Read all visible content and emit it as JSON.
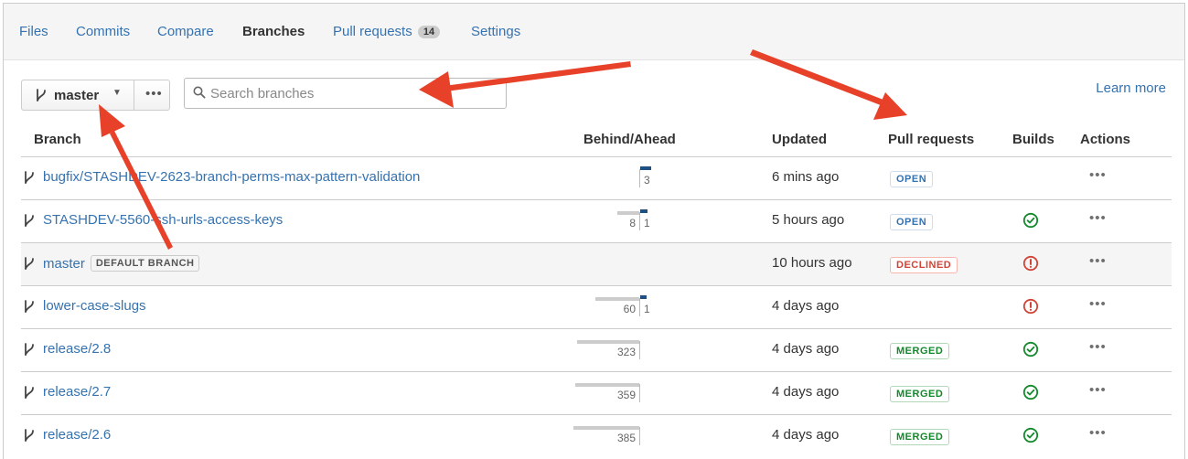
{
  "tabs": [
    {
      "label": "Files"
    },
    {
      "label": "Commits"
    },
    {
      "label": "Compare"
    },
    {
      "label": "Branches"
    },
    {
      "label": "Pull requests",
      "count": "14"
    },
    {
      "label": "Settings"
    }
  ],
  "toolbar": {
    "branch_selector": "master",
    "more_label": "•••",
    "search_placeholder": "Search branches",
    "learn_more": "Learn more"
  },
  "columns": {
    "branch": "Branch",
    "behind_ahead": "Behind/Ahead",
    "updated": "Updated",
    "pull_requests": "Pull requests",
    "builds": "Builds",
    "actions": "Actions"
  },
  "rows": [
    {
      "name": "bugfix/STASHDEV-2623-branch-perms-max-pattern-validation",
      "behind": "",
      "ahead": "3",
      "updated": "6 mins ago",
      "pr_status": "OPEN",
      "build": "",
      "actions": "•••"
    },
    {
      "name": "STASHDEV-5560-ssh-urls-access-keys",
      "behind": "8",
      "ahead": "1",
      "updated": "5 hours ago",
      "pr_status": "OPEN",
      "build": "success",
      "actions": "•••"
    },
    {
      "name": "master",
      "badge": "DEFAULT BRANCH",
      "behind": "",
      "ahead": "",
      "updated": "10 hours ago",
      "pr_status": "DECLINED",
      "build": "failed",
      "actions": "•••"
    },
    {
      "name": "lower-case-slugs",
      "behind": "60",
      "ahead": "1",
      "updated": "4 days ago",
      "pr_status": "",
      "build": "failed",
      "actions": "•••"
    },
    {
      "name": "release/2.8",
      "behind": "323",
      "ahead": "",
      "updated": "4 days ago",
      "pr_status": "MERGED",
      "build": "success",
      "actions": "•••"
    },
    {
      "name": "release/2.7",
      "behind": "359",
      "ahead": "",
      "updated": "4 days ago",
      "pr_status": "MERGED",
      "build": "success",
      "actions": "•••"
    },
    {
      "name": "release/2.6",
      "behind": "385",
      "ahead": "",
      "updated": "4 days ago",
      "pr_status": "MERGED",
      "build": "success",
      "actions": "•••"
    }
  ],
  "icons": {
    "branch": "branch-icon",
    "search": "search-icon",
    "success": "check-circle-icon",
    "failed": "exclamation-circle-icon"
  },
  "colors": {
    "link": "#3572b0",
    "success": "#14892c",
    "error": "#d04437",
    "annotation_arrow": "#e8412a"
  }
}
